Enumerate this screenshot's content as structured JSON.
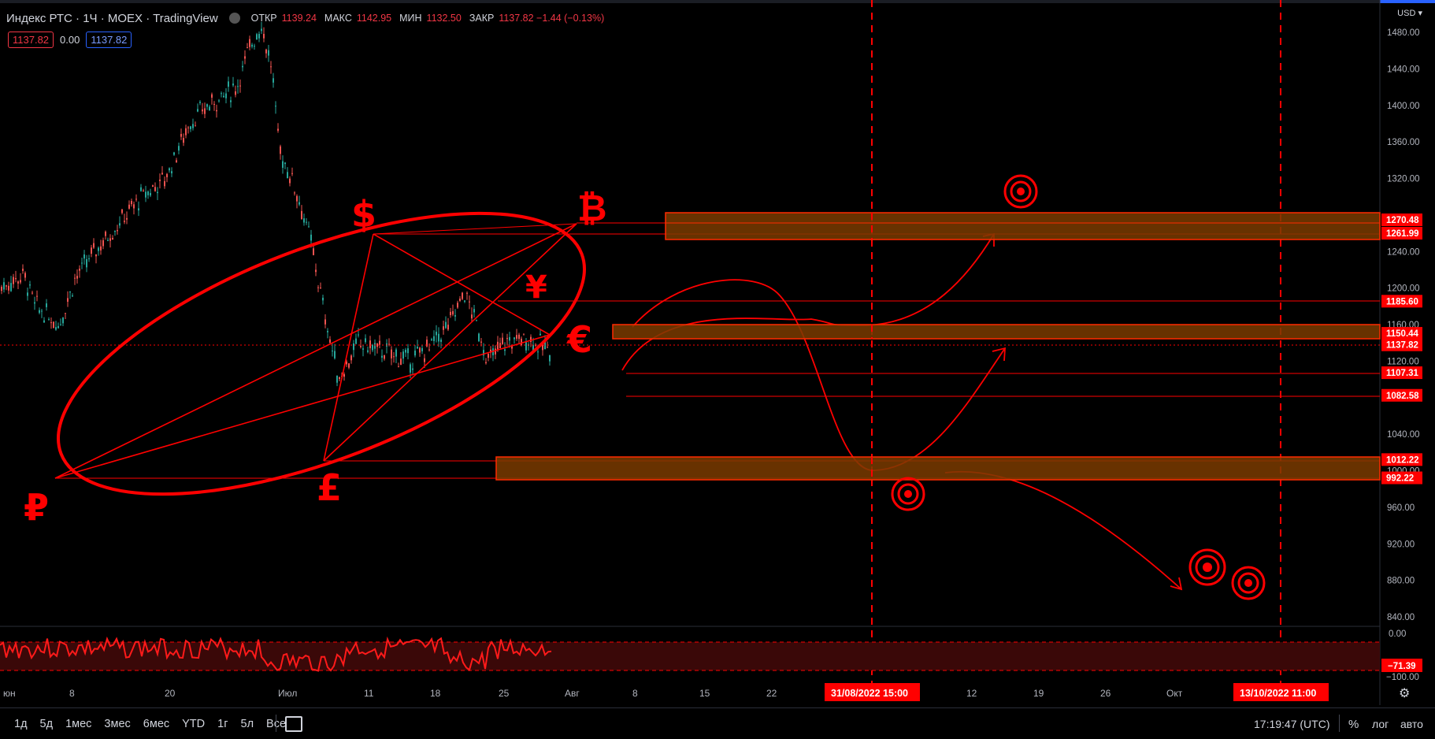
{
  "header": {
    "symbol": "Индекс РТС · 1Ч · MOEX · TradingView",
    "open_label": "ОТКР",
    "open_value": "1139.24",
    "high_label": "МАКС",
    "high_value": "1142.95",
    "low_label": "МИН",
    "low_value": "1132.50",
    "close_label": "ЗАКР",
    "close_value": "1137.82 −1.44 (−0.13%)",
    "badge_sell": "1137.82",
    "badge_spread": "0.00",
    "badge_buy": "1137.82",
    "currency": "USD"
  },
  "price_axis": {
    "ticks": [
      "1480.00",
      "1440.00",
      "1400.00",
      "1360.00",
      "1320.00",
      "1240.00",
      "1200.00",
      "1160.00",
      "1120.00",
      "1040.00",
      "1000.00",
      "960.00",
      "920.00",
      "880.00",
      "840.00"
    ],
    "labels": [
      "1270.48",
      "1261.99",
      "1185.60",
      "1150.44",
      "1137.82",
      "1107.31",
      "1082.58",
      "1012.22",
      "992.22"
    ]
  },
  "rsi_axis": {
    "ticks": [
      "0.00",
      "−100.00"
    ],
    "value": "−71.39"
  },
  "time_axis": {
    "ticks": [
      "юн",
      "8",
      "20",
      "Июл",
      "11",
      "18",
      "25",
      "Авг",
      "8",
      "15",
      "22",
      "12",
      "19",
      "26",
      "Окт"
    ],
    "marker1": "31/08/2022  15:00",
    "marker2": "13/10/2022  11:00"
  },
  "symbols": {
    "ruble": "₽",
    "dollar": "$",
    "bitcoin": "₿",
    "yen": "¥",
    "euro": "€",
    "pound": "£"
  },
  "bottombar": {
    "timeframes": [
      "1д",
      "5д",
      "1мес",
      "3мес",
      "6мес",
      "YTD",
      "1г",
      "5л",
      "Все"
    ],
    "clock": "17:19:47 (UTC)",
    "percent": "%",
    "log": "лог",
    "auto": "авто"
  },
  "colors": {
    "accent": "#ff0000",
    "zone": "#7a3b00",
    "label_bg": "#ff0000",
    "candle_up": "#26a69a",
    "candle_down": "#ef5350"
  }
}
